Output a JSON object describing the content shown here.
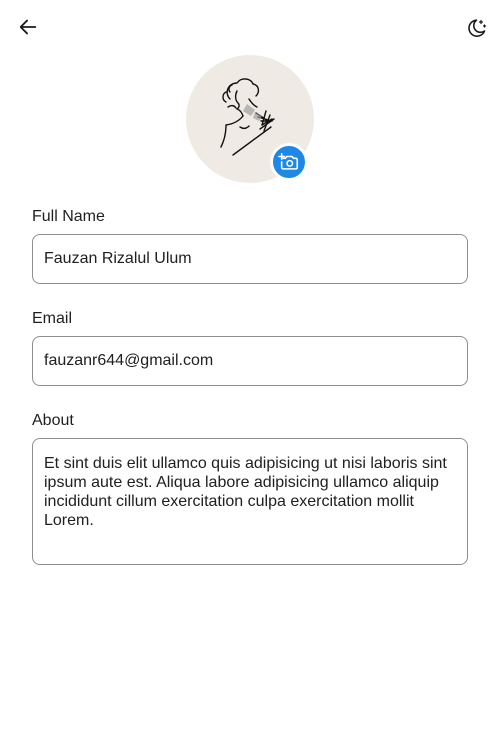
{
  "header": {
    "back_icon": "arrow-left-icon",
    "theme_icon": "moon-stars-icon"
  },
  "avatar": {
    "camera_icon": "camera-add-icon",
    "accent_color": "#1e88e5"
  },
  "form": {
    "full_name": {
      "label": "Full Name",
      "value": "Fauzan Rizalul Ulum"
    },
    "email": {
      "label": "Email",
      "value": "fauzanr644@gmail.com"
    },
    "about": {
      "label": "About",
      "value": "Et sint duis elit ullamco quis adipisicing ut nisi laboris sint ipsum aute est. Aliqua labore adipisicing ullamco aliquip incididunt cillum exercitation culpa exercitation mollit Lorem."
    }
  }
}
